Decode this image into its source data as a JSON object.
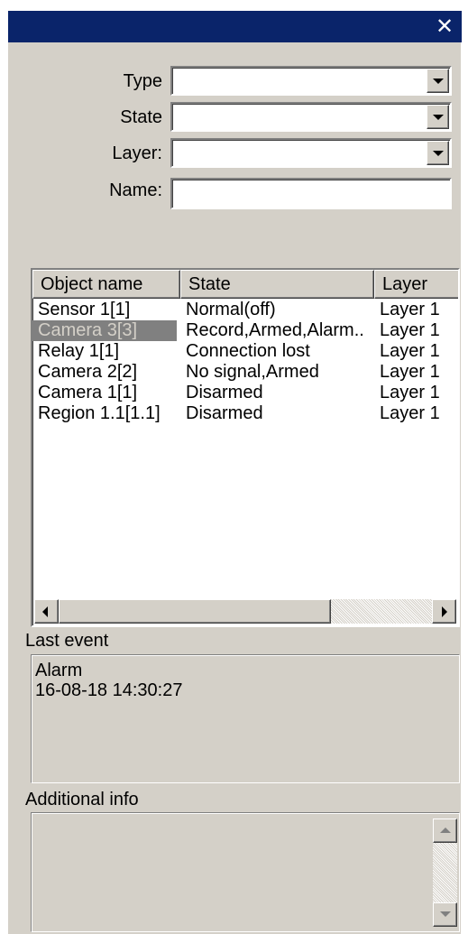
{
  "window": {
    "close_glyph": "✕"
  },
  "filters": {
    "type": {
      "label": "Type",
      "value": ""
    },
    "state": {
      "label": "State",
      "value": ""
    },
    "layer": {
      "label": "Layer:",
      "value": ""
    },
    "name": {
      "label": "Name:",
      "value": ""
    }
  },
  "objects": {
    "columns": [
      "Object name",
      "State",
      "Layer"
    ],
    "rows": [
      {
        "name": "Sensor 1[1]",
        "state": "Normal(off)",
        "layer": "Layer 1",
        "selected": false
      },
      {
        "name": "Camera 3[3]",
        "state": "Record,Armed,Alarm..",
        "layer": "Layer 1",
        "selected": true
      },
      {
        "name": "Relay 1[1]",
        "state": "Connection lost",
        "layer": "Layer 1",
        "selected": false
      },
      {
        "name": "Camera 2[2]",
        "state": "No signal,Armed",
        "layer": "Layer 1",
        "selected": false
      },
      {
        "name": "Camera 1[1]",
        "state": "Disarmed",
        "layer": "Layer 1",
        "selected": false
      },
      {
        "name": "Region 1.1[1.1]",
        "state": "Disarmed",
        "layer": "Layer 1",
        "selected": false
      }
    ]
  },
  "last_event": {
    "label": "Last event",
    "line1": "Alarm",
    "line2": "16-08-18 14:30:27"
  },
  "additional_info": {
    "label": "Additional info",
    "text": ""
  },
  "colors": {
    "titlebar": "#0a246a",
    "face": "#d4d0c8",
    "selection": "#808080"
  },
  "icons": {
    "close": "close-icon",
    "dropdown": "chevron-down-icon",
    "scroll_left": "arrow-left-icon",
    "scroll_right": "arrow-right-icon",
    "scroll_up": "arrow-up-icon",
    "scroll_down": "arrow-down-icon"
  }
}
